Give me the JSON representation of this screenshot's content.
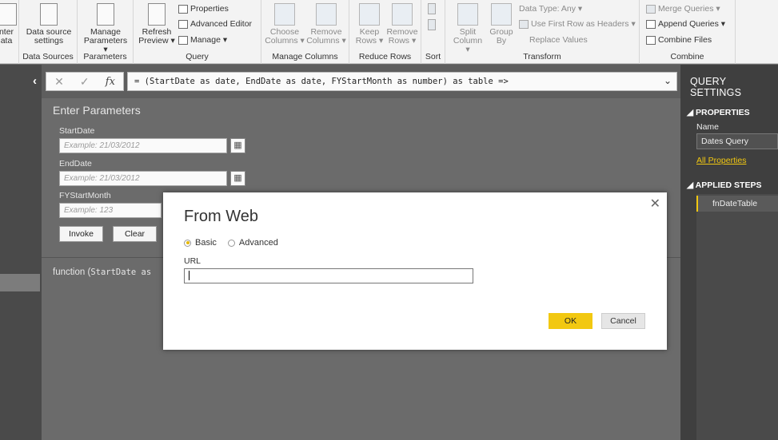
{
  "ribbon": {
    "get_data": {
      "label": "nter\nata"
    },
    "data_source": {
      "label": "Data source settings",
      "group": "Data Sources"
    },
    "parameters": {
      "label": "Manage Parameters ▾",
      "group": "Parameters"
    },
    "query": {
      "group": "Query",
      "refresh": "Refresh Preview ▾",
      "properties": "Properties",
      "advanced_editor": "Advanced Editor",
      "manage": "Manage ▾"
    },
    "manage_columns": {
      "group": "Manage Columns",
      "choose": "Choose Columns ▾",
      "remove": "Remove Columns ▾"
    },
    "reduce_rows": {
      "group": "Reduce Rows",
      "keep": "Keep Rows ▾",
      "remove": "Remove Rows ▾"
    },
    "sort": {
      "group": "Sort"
    },
    "transform": {
      "group": "Transform",
      "split": "Split Column ▾",
      "group_by": "Group By",
      "data_type": "Data Type: Any ▾",
      "first_row": "Use First Row as Headers ▾",
      "replace": "Replace Values"
    },
    "combine": {
      "group": "Combine",
      "merge": "Merge Queries ▾",
      "append": "Append Queries ▾",
      "files": "Combine Files"
    }
  },
  "formula_bar": {
    "cancel_glyph": "✕",
    "check_glyph": "✓",
    "fx_glyph": "fx",
    "text": "= (StartDate as date, EndDate as date, FYStartMonth as number) as table =>"
  },
  "parameters_pane": {
    "title": "Enter Parameters",
    "start_label": "StartDate",
    "start_placeholder": "Example: 21/03/2012",
    "end_label": "EndDate",
    "end_placeholder": "Example: 21/03/2012",
    "fy_label": "FYStartMonth",
    "fy_placeholder": "Example: 123",
    "invoke": "Invoke",
    "clear": "Clear",
    "function_prefix": "function (",
    "function_mono": "StartDate as"
  },
  "query_settings": {
    "title": "QUERY SETTINGS",
    "properties": "PROPERTIES",
    "name_label": "Name",
    "name_value": "Dates Query",
    "all_properties": "All Properties",
    "applied_steps": "APPLIED STEPS",
    "steps": [
      "fnDateTable"
    ]
  },
  "dialog": {
    "title": "From Web",
    "radio_basic": "Basic",
    "radio_advanced": "Advanced",
    "selected": "Basic",
    "url_label": "URL",
    "url_value": "",
    "ok": "OK",
    "cancel": "Cancel",
    "close_glyph": "✕"
  },
  "colors": {
    "accent": "#f2c811",
    "panel": "#3f3f3f",
    "backdrop": "#6b6b6b"
  }
}
